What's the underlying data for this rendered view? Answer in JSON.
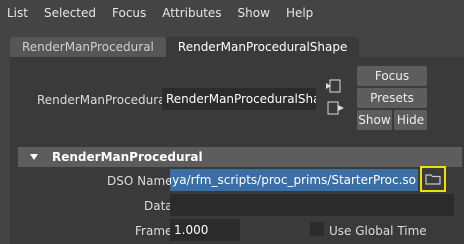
{
  "menu": [
    "List",
    "Selected",
    "Focus",
    "Attributes",
    "Show",
    "Help"
  ],
  "tabs": [
    {
      "label": "RenderManProcedural"
    },
    {
      "label": "RenderManProceduralShape"
    }
  ],
  "node": {
    "label": "RenderManProcedural:",
    "value": "RenderManProceduralShape"
  },
  "buttons": {
    "focus": "Focus",
    "presets": "Presets",
    "show": "Show",
    "hide": "Hide"
  },
  "section": {
    "title": "RenderManProcedural"
  },
  "fields": {
    "dso_label": "DSO Name",
    "dso_value": "/maya/rfm_scripts/proc_prims/StarterProc.so",
    "data_label": "Data",
    "data_value": "",
    "frame_label": "Frame",
    "frame_value": "1.000",
    "use_global_time_label": "Use Global Time"
  },
  "colors": {
    "selection": "#3a6ea5",
    "highlight": "#f0e000"
  }
}
